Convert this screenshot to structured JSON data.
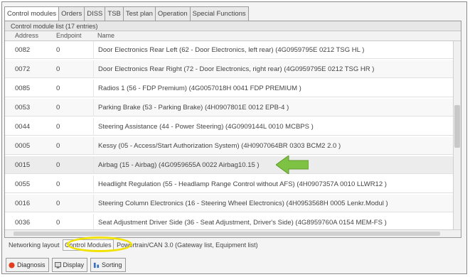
{
  "tabs": [
    "Control modules",
    "Orders",
    "DISS",
    "TSB",
    "Test plan",
    "Operation",
    "Special Functions"
  ],
  "panel_title": "Control module list (17 entries)",
  "columns": {
    "address": "Address",
    "endpoint": "Endpoint",
    "name": "Name"
  },
  "rows": [
    {
      "address": "0082",
      "endpoint": "0",
      "name": "Door Electronics Rear Left (62 - Door Electronics, left rear) (4G0959795E 0212 TSG HL )"
    },
    {
      "address": "0072",
      "endpoint": "0",
      "name": "Door Electronics Rear Right (72 - Door Electronics, right rear) (4G0959795E 0212 TSG HR )"
    },
    {
      "address": "0085",
      "endpoint": "0",
      "name": "Radios 1 (56 - FDP Premium) (4G0057018H 0041 FDP PREMIUM )"
    },
    {
      "address": "0053",
      "endpoint": "0",
      "name": "Parking Brake (53 - Parking Brake) (4H0907801E 0012 EPB-4 )"
    },
    {
      "address": "0044",
      "endpoint": "0",
      "name": "Steering Assistance (44 - Power Steering) (4G0909144L 0010 MCBPS )"
    },
    {
      "address": "0005",
      "endpoint": "0",
      "name": "Kessy (05 - Access/Start Authorization System) (4H0907064BR 0303 BCM2 2.0 )"
    },
    {
      "address": "0015",
      "endpoint": "0",
      "name": "Airbag (15 - Airbag) (4G0959655A 0022 Airbag10.15 )"
    },
    {
      "address": "0055",
      "endpoint": "0",
      "name": "Headlight Regulation (55 - Headlamp Range Control without AFS) (4H0907357A 0010 LLWR12 )"
    },
    {
      "address": "0016",
      "endpoint": "0",
      "name": "Steering Column Electronics (16 - Steering Wheel Electronics) (4H0953568H 0005 Lenkr.Modul )"
    },
    {
      "address": "0036",
      "endpoint": "0",
      "name": "Seat Adjustment Driver Side (36 - Seat Adjustment, Driver's Side) (4G8959760A 0154 MEM-FS )"
    }
  ],
  "status": {
    "prefix": "Networking layout",
    "highlighted": "Control Modules",
    "suffix": "Powertrain/CAN 3.0 (Gateway list, Equipment list)"
  },
  "buttons": [
    {
      "label": "Diagnosis",
      "icon": "stop-diagnosis-icon"
    },
    {
      "label": "Display",
      "icon": "display-icon"
    },
    {
      "label": "Sorting",
      "icon": "sorting-icon"
    }
  ],
  "colors": {
    "arrow": "#7dc242",
    "highlight": "#f2e200"
  }
}
